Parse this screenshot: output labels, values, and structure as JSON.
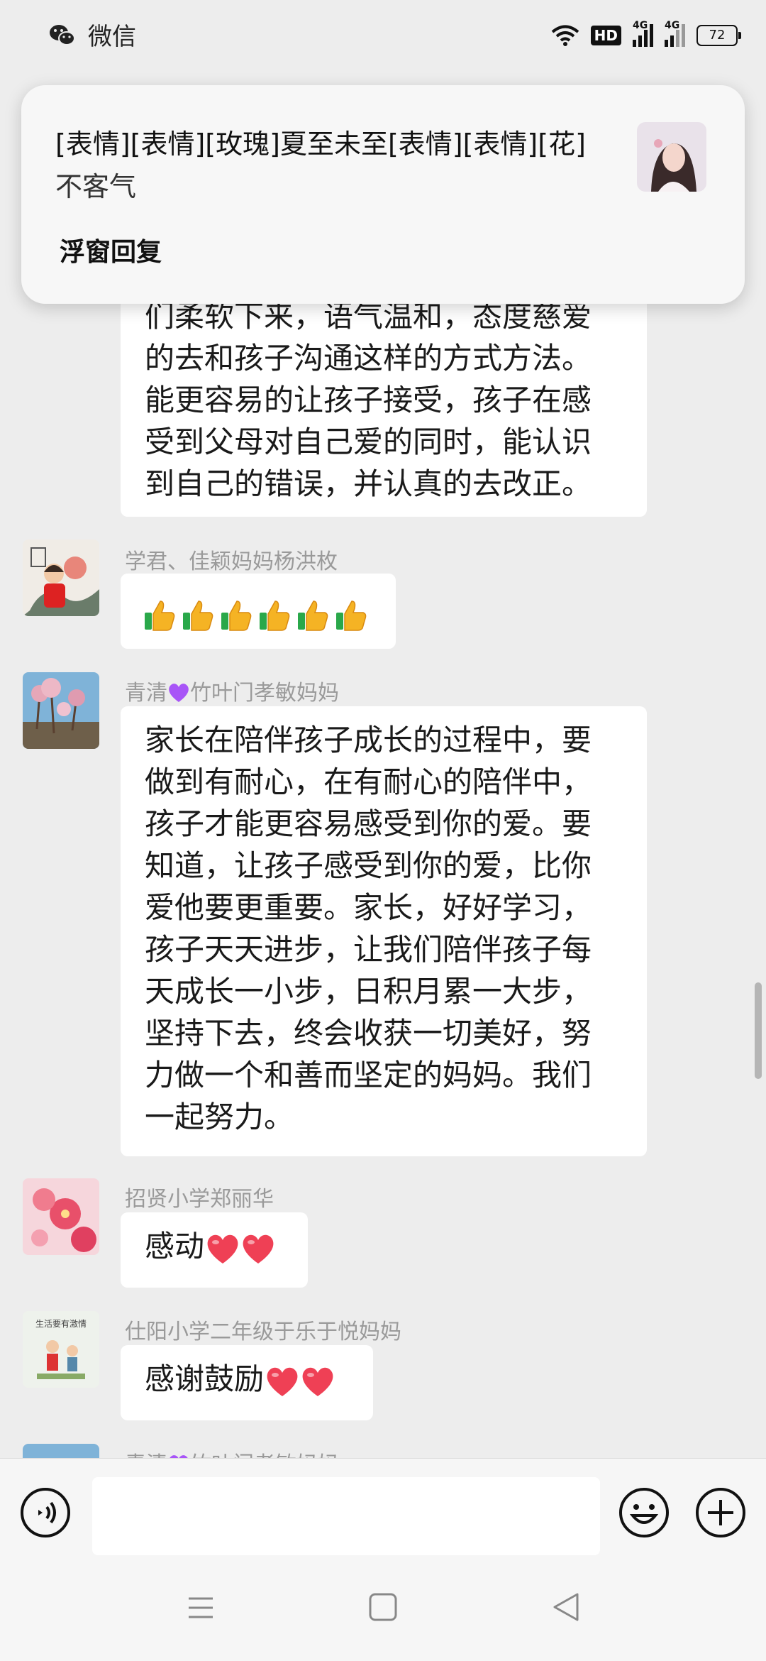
{
  "status_bar": {
    "app_name": "微信",
    "hd_label": "HD",
    "network_1": "4G",
    "network_2": "4G",
    "battery": "72"
  },
  "notification": {
    "title": "[表情][表情][玫瑰]夏至未至[表情][表情][花]",
    "body": "不客气",
    "reply_label": "浮窗回复"
  },
  "messages": [
    {
      "sender": "",
      "lines": [
        "们柔软下来，语气温和，态度慈爱",
        "的去和孩子沟通这样的方式方法。",
        "能更容易的让孩子接受，孩子在感",
        "受到父母对自己爱的同时，能认识",
        "到自己的错误，并认真的去改正。"
      ]
    },
    {
      "sender": "学君、佳颖妈妈杨洪枚",
      "emoji": "thumbs-up",
      "emoji_count": 6
    },
    {
      "sender_prefix": "青清",
      "sender_emoji": "purple-heart",
      "sender_suffix": "竹叶门孝敏妈妈",
      "lines": [
        "家长在陪伴孩子成长的过程中，要",
        "做到有耐心，在有耐心的陪伴中，",
        "孩子才能更容易感受到你的爱。要",
        "知道，让孩子感受到你的爱，比你",
        "爱他要更重要。家长，好好学习，",
        "孩子天天进步，让我们陪伴孩子每",
        "天成长一小步，日积月累一大步，",
        "坚持下去，终会收获一切美好，努",
        "力做一个和善而坚定的妈妈。我们",
        "一起努力。"
      ]
    },
    {
      "sender": "招贤小学郑丽华",
      "text": "感动",
      "emoji": "red-heart",
      "emoji_count": 2
    },
    {
      "sender": "仕阳小学二年级于乐于悦妈妈",
      "text": "感谢鼓励",
      "emoji": "red-heart",
      "emoji_count": 2,
      "avatar_caption": "生活要有激情"
    },
    {
      "sender_prefix": "青清",
      "sender_emoji": "purple-heart",
      "sender_suffix": "竹叶门孝敏妈妈"
    }
  ],
  "input": {
    "placeholder": ""
  },
  "colors": {
    "background": "#ededed",
    "bubble": "#ffffff",
    "sender_text": "#9a9a9a",
    "notification_bg": "#f7f7f7"
  }
}
